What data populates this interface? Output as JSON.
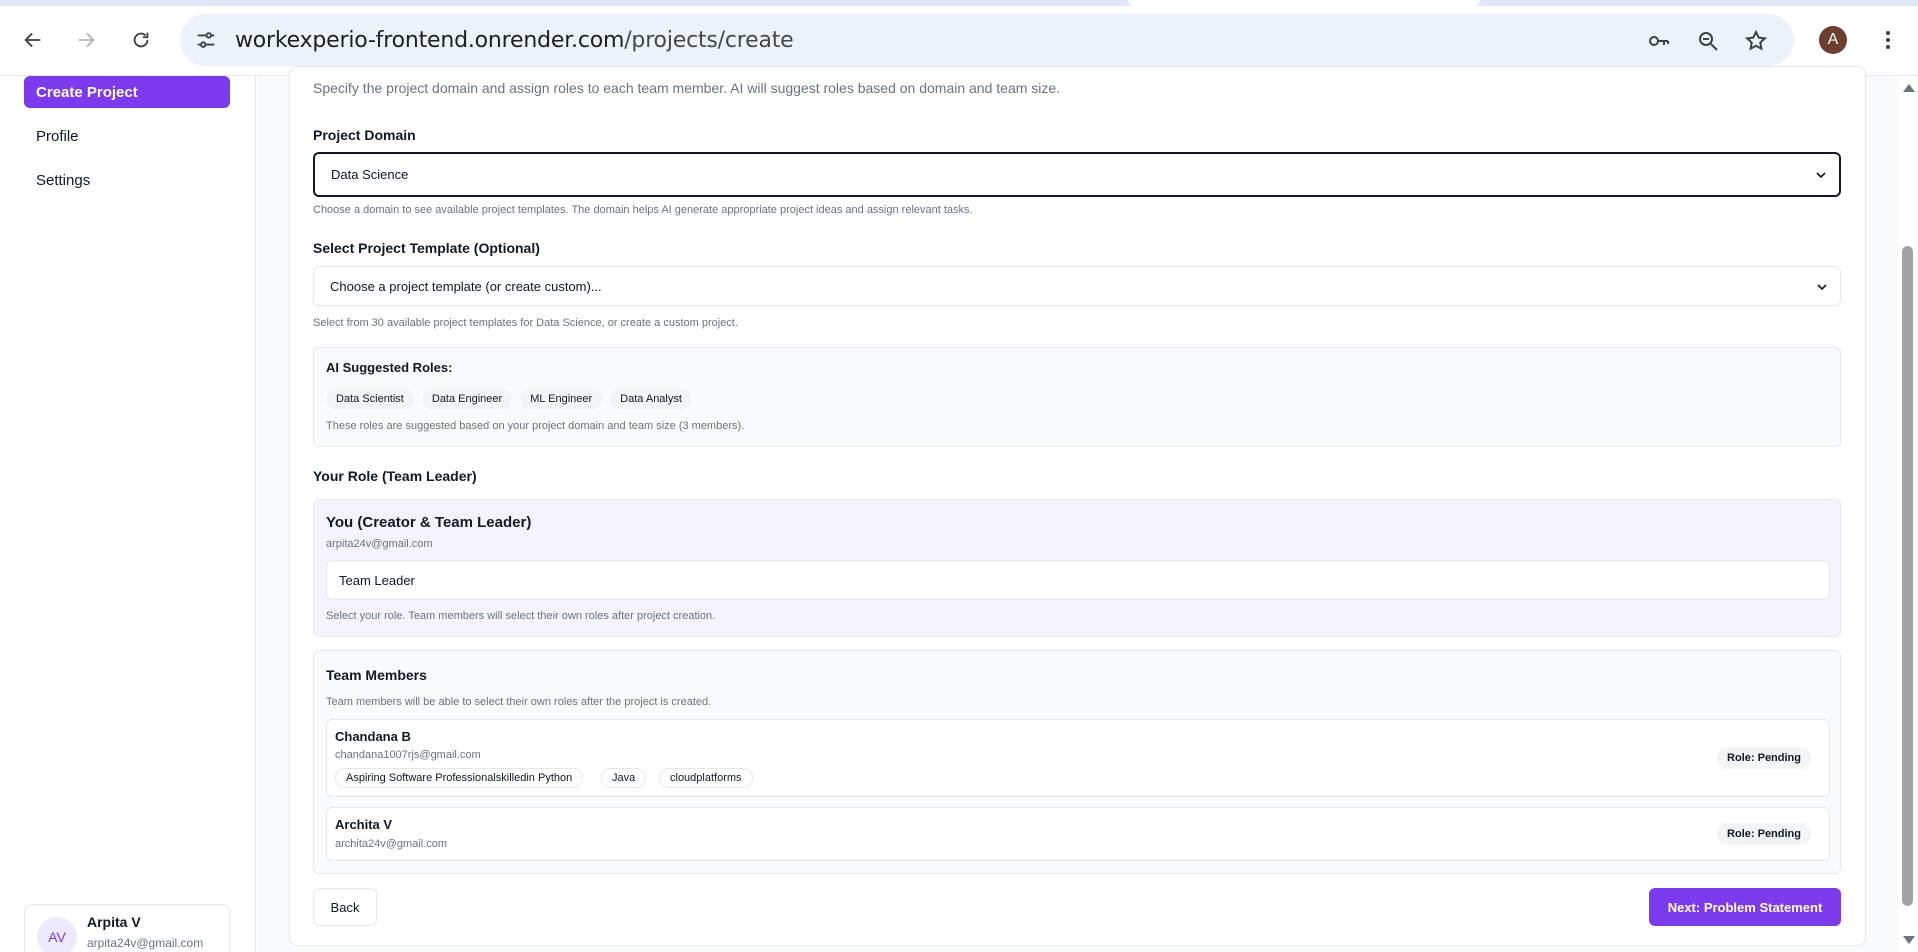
{
  "browser": {
    "url_host": "workexperio-frontend.onrender.com",
    "url_path": "/projects/create",
    "profile_initial": "A"
  },
  "sidebar": {
    "items": [
      {
        "label": "Create Project",
        "active": true
      },
      {
        "label": "Profile",
        "active": false
      },
      {
        "label": "Settings",
        "active": false
      }
    ],
    "user": {
      "initials": "AV",
      "name": "Arpita V",
      "email": "arpita24v@gmail.com"
    }
  },
  "main": {
    "intro": "Specify the project domain and assign roles to each team member. AI will suggest roles based on domain and team size.",
    "domain": {
      "label": "Project Domain",
      "value": "Data Science",
      "help": "Choose a domain to see available project templates. The domain helps AI generate appropriate project ideas and assign relevant tasks."
    },
    "template": {
      "label": "Select Project Template (Optional)",
      "placeholder": "Choose a project template (or create custom)...",
      "help": "Select from 30 available project templates for Data Science, or create a custom project."
    },
    "ai_roles": {
      "title": "AI Suggested Roles:",
      "roles": [
        "Data Scientist",
        "Data Engineer",
        "ML Engineer",
        "Data Analyst"
      ],
      "note": "These roles are suggested based on your project domain and team size (3 members)."
    },
    "your_role": {
      "section_label": "Your Role (Team Leader)",
      "title": "You (Creator & Team Leader)",
      "email": "arpita24v@gmail.com",
      "value": "Team Leader",
      "help": "Select your role. Team members will select their own roles after project creation."
    },
    "team": {
      "title": "Team Members",
      "note": "Team members will be able to select their own roles after the project is created.",
      "members": [
        {
          "name": "Chandana B",
          "email": "chandana1007rjs@gmail.com",
          "skills": [
            "Aspiring Software Professionalskilledin Python",
            "Java",
            "cloudplatforms"
          ],
          "role": "Role: Pending"
        },
        {
          "name": "Archita V",
          "email": "archita24v@gmail.com",
          "skills": [],
          "role": "Role: Pending"
        }
      ]
    },
    "buttons": {
      "back": "Back",
      "next": "Next: Problem Statement"
    }
  },
  "colors": {
    "accent": "#7c3aed",
    "border": "#e5e7eb",
    "muted_text": "#6b7280"
  }
}
